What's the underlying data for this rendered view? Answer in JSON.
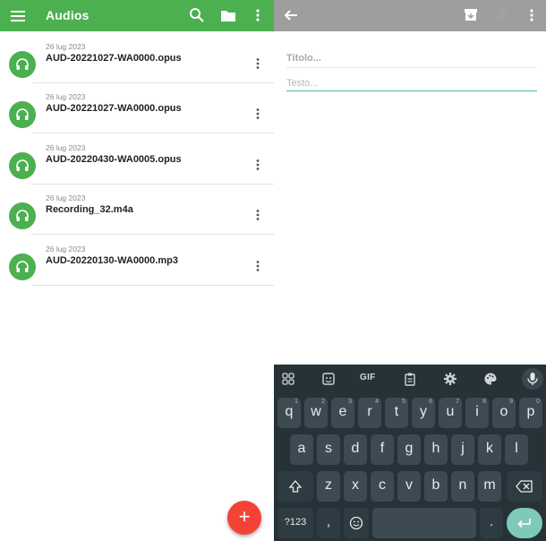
{
  "left_app": {
    "title": "Audios",
    "icons": [
      "menu-icon",
      "search-icon",
      "folder-icon",
      "more-vert-icon"
    ],
    "accent_color": "#4CAF50",
    "items": [
      {
        "date": "26 lug 2023",
        "name": "AUD-20221027-WA0000.opus"
      },
      {
        "date": "26 lug 2023",
        "name": "AUD-20221027-WA0000.opus"
      },
      {
        "date": "26 lug 2023",
        "name": "AUD-20220430-WA0005.opus"
      },
      {
        "date": "26 lug 2023",
        "name": "Recording_32.m4a"
      },
      {
        "date": "26 lug 2023",
        "name": "AUD-20220130-WA0000.mp3"
      }
    ],
    "fab_label": "+",
    "fab_color": "#F44336"
  },
  "right_app": {
    "appbar_color": "#9e9e9e",
    "icons": [
      "back-arrow-icon",
      "archive-icon",
      "delete-icon",
      "more-vert-icon"
    ],
    "title_placeholder": "Titolo...",
    "body_placeholder": "Testo..."
  },
  "keyboard": {
    "toolbar": {
      "gif_label": "GIF",
      "icons": [
        "apps-grid-icon",
        "sticker-icon",
        "clipboard-icon",
        "settings-icon",
        "palette-icon",
        "mic-icon"
      ]
    },
    "row1": [
      {
        "label": "q",
        "hint": "1"
      },
      {
        "label": "w",
        "hint": "2"
      },
      {
        "label": "e",
        "hint": "3"
      },
      {
        "label": "r",
        "hint": "4"
      },
      {
        "label": "t",
        "hint": "5"
      },
      {
        "label": "y",
        "hint": "6"
      },
      {
        "label": "u",
        "hint": "7"
      },
      {
        "label": "i",
        "hint": "8"
      },
      {
        "label": "o",
        "hint": "9"
      },
      {
        "label": "p",
        "hint": "0"
      }
    ],
    "row2": [
      "a",
      "s",
      "d",
      "f",
      "g",
      "h",
      "j",
      "k",
      "l"
    ],
    "row3": [
      "z",
      "x",
      "c",
      "v",
      "b",
      "n",
      "m"
    ],
    "bottom": {
      "symbols_label": "?123",
      "comma_label": ",",
      "period_label": "."
    },
    "enter_color": "#7fc9b8"
  }
}
